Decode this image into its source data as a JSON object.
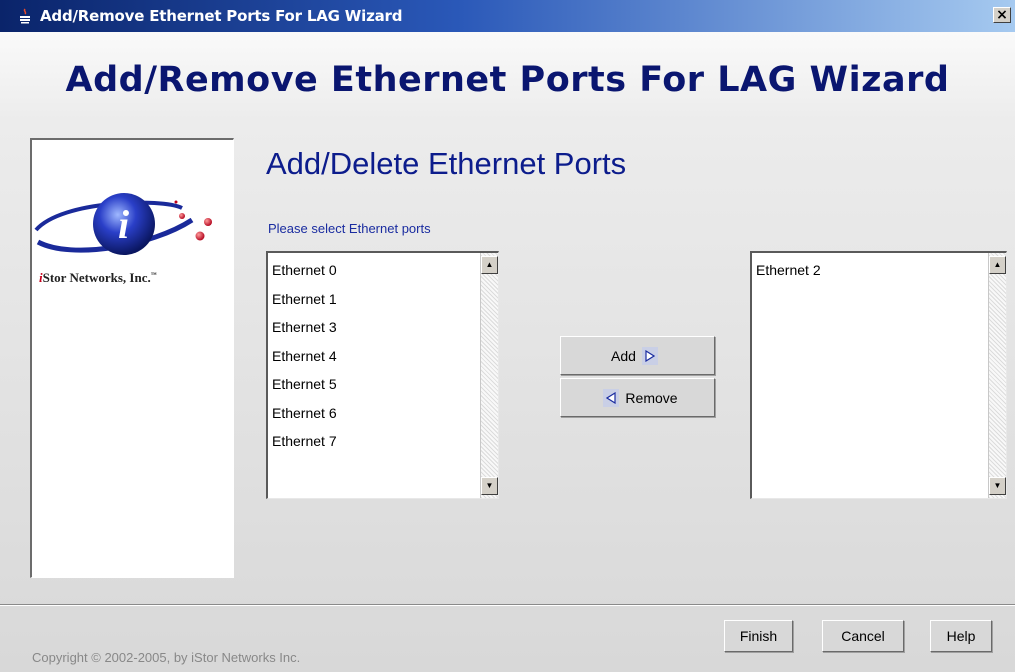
{
  "window": {
    "title": "Add/Remove Ethernet Ports For LAG Wizard",
    "close_label": "×"
  },
  "banner": {
    "title": "Add/Remove Ethernet Ports For LAG Wizard"
  },
  "logo": {
    "i_mark": "i",
    "company_prefix": "i",
    "company_rest": "Stor Networks, Inc.",
    "trademark": "™"
  },
  "main": {
    "section_title": "Add/Delete Ethernet Ports",
    "instruction": "Please select Ethernet ports",
    "available_ports": [
      "Ethernet 0",
      "Ethernet 1",
      "Ethernet 3",
      "Ethernet 4",
      "Ethernet 5",
      "Ethernet 6",
      "Ethernet 7"
    ],
    "selected_ports": [
      "Ethernet 2"
    ],
    "add_label": "Add",
    "remove_label": "Remove"
  },
  "footer": {
    "copyright": "Copyright © 2002-2005, by iStor Networks Inc.",
    "finish_label": "Finish",
    "cancel_label": "Cancel",
    "help_label": "Help"
  },
  "colors": {
    "title_bar": "#0a246a",
    "heading": "#0a1670",
    "accent": "#1a2ca0"
  },
  "icons": {
    "app": "java-cup-icon",
    "close": "close-icon",
    "add_arrow": "arrow-right-icon",
    "remove_arrow": "arrow-left-icon",
    "scroll_up": "scroll-up-icon",
    "scroll_down": "scroll-down-icon"
  }
}
